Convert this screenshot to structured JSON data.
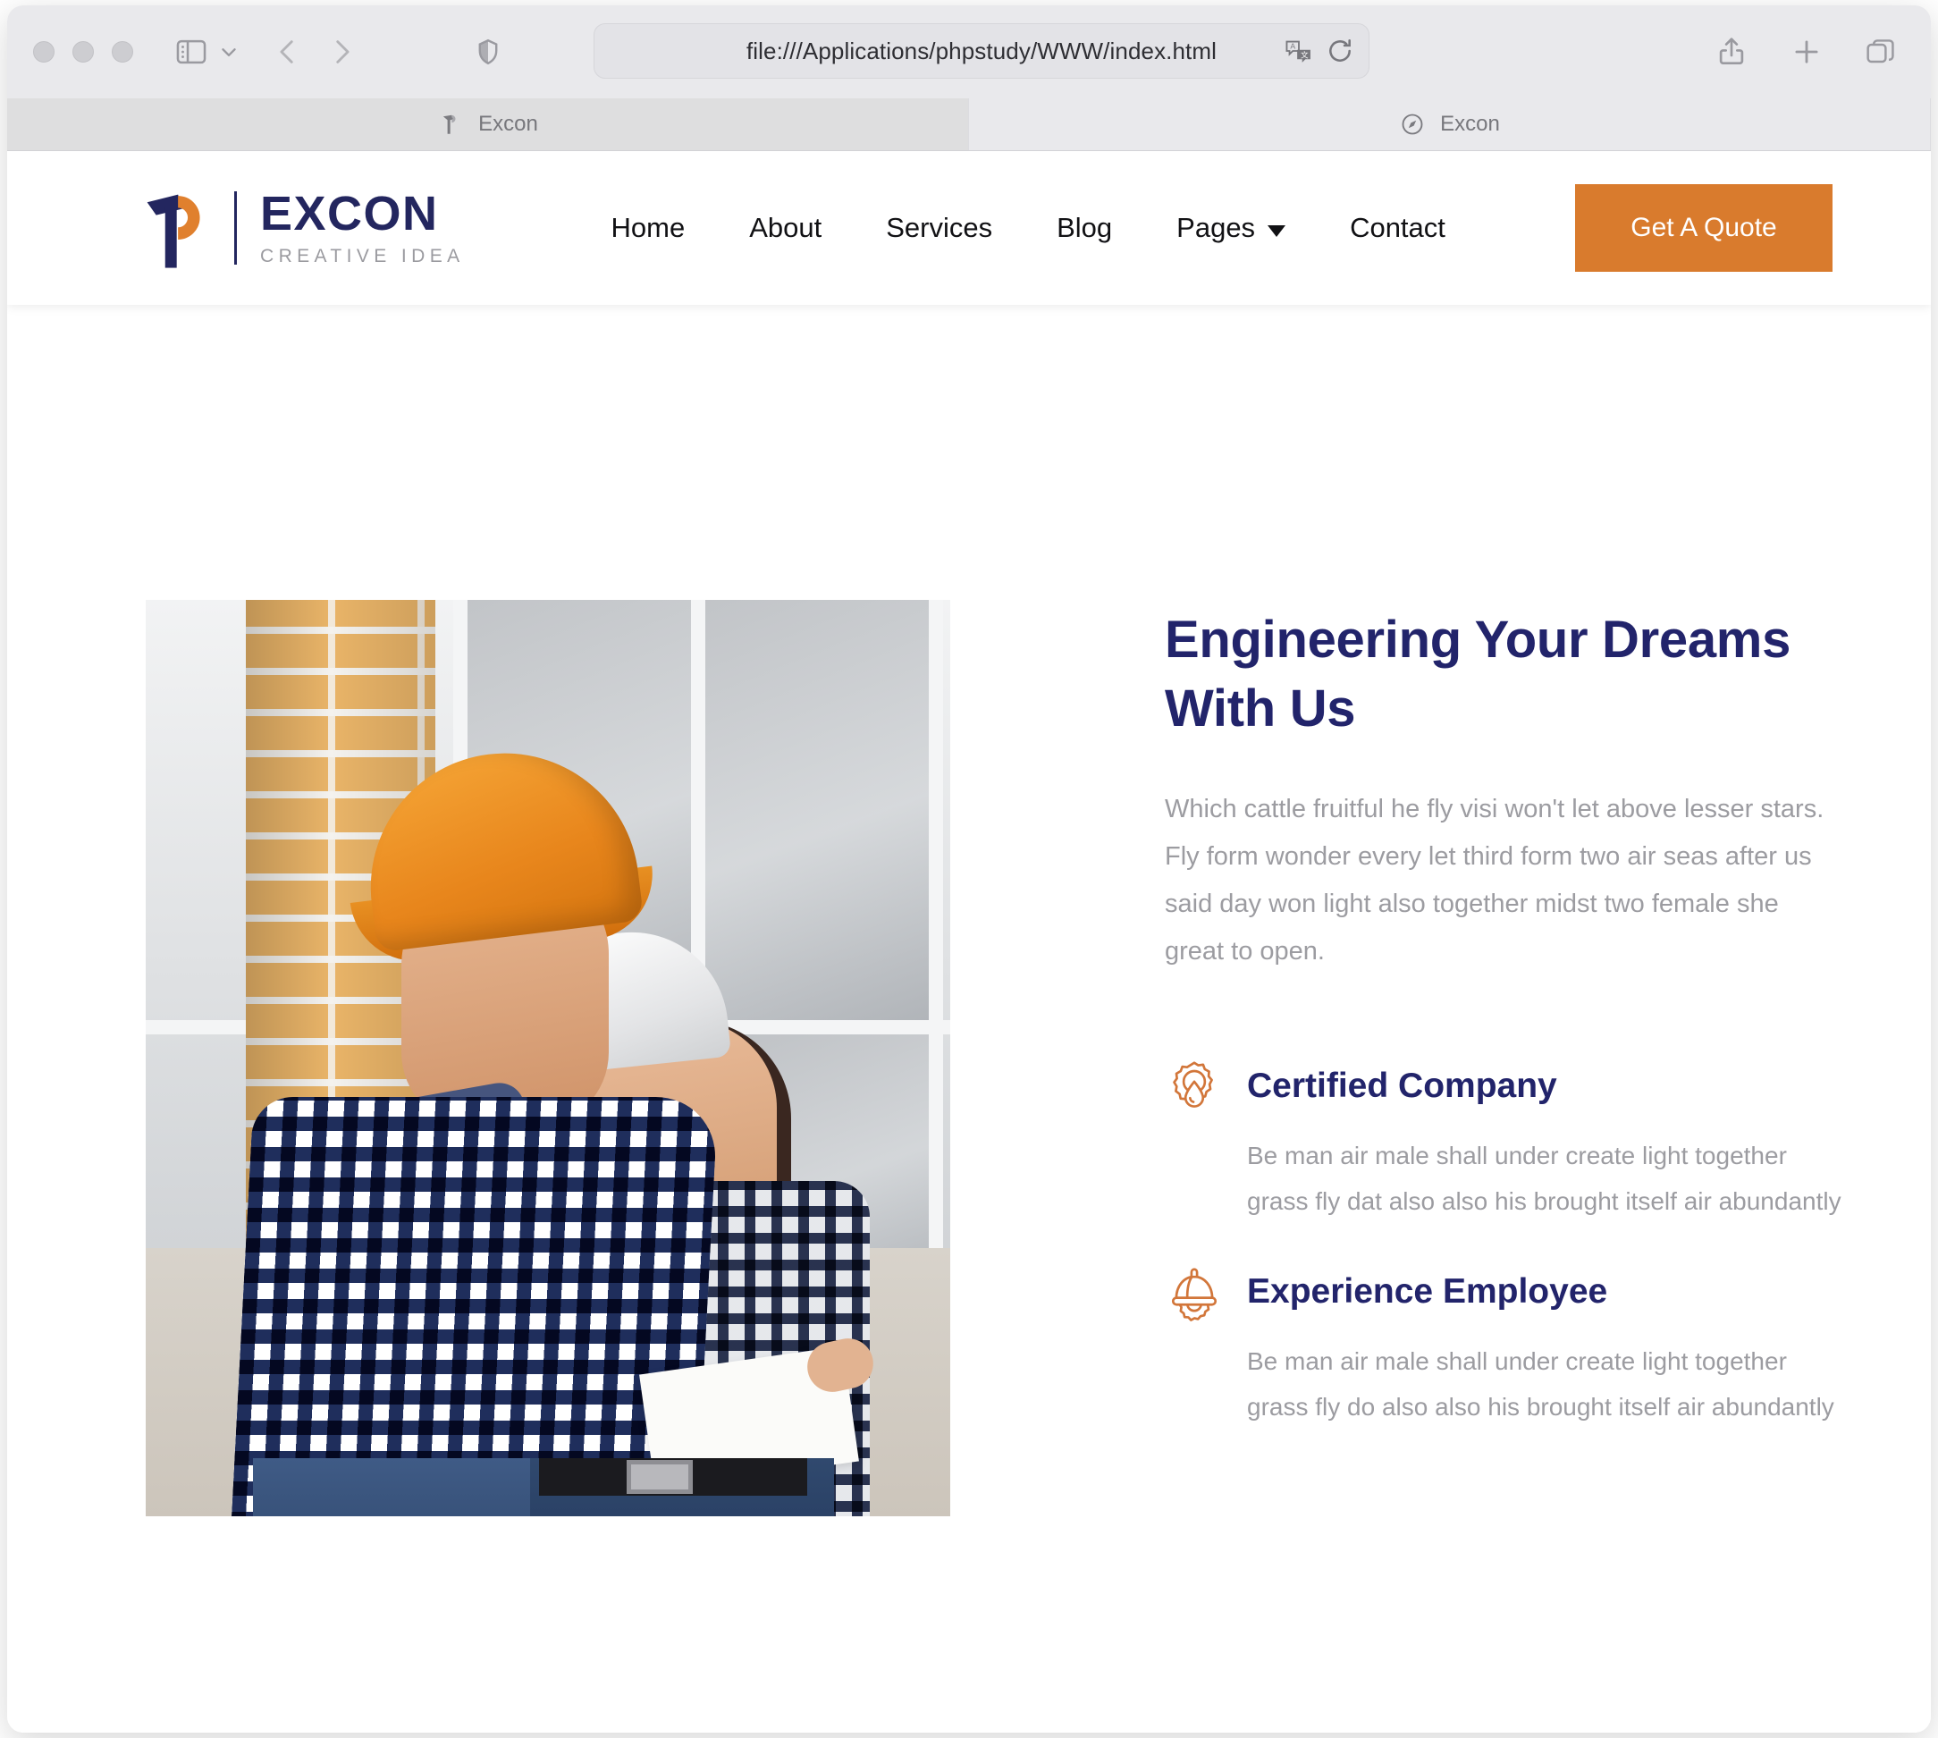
{
  "browser": {
    "url": "file:///Applications/phpstudy/WWW/index.html",
    "tabs": [
      {
        "title": "Excon",
        "favicon": "hammer-icon",
        "active": true
      },
      {
        "title": "Excon",
        "favicon": "compass-icon",
        "active": false
      }
    ],
    "toolbar": {
      "sidebar_icon": "sidebar-icon",
      "sidebar_chevron_icon": "chevron-down-icon",
      "back_icon": "chevron-left-icon",
      "forward_icon": "chevron-right-icon",
      "shield_icon": "shield-icon",
      "translate_icon": "translate-icon",
      "reload_icon": "reload-icon",
      "share_icon": "share-icon",
      "new_tab_icon": "plus-icon",
      "tab_overview_icon": "tab-overview-icon"
    }
  },
  "site": {
    "brand": {
      "name": "EXCON",
      "tagline": "CREATIVE IDEA",
      "logo_icon": "hammer-logo-icon"
    },
    "nav": [
      {
        "label": "Home",
        "has_dropdown": false
      },
      {
        "label": "About",
        "has_dropdown": false
      },
      {
        "label": "Services",
        "has_dropdown": false
      },
      {
        "label": "Blog",
        "has_dropdown": false
      },
      {
        "label": "Pages",
        "has_dropdown": true
      },
      {
        "label": "Contact",
        "has_dropdown": false
      }
    ],
    "cta": {
      "label": "Get A Quote"
    },
    "hero": {
      "title": "Engineering Your Dreams With Us",
      "lead": "Which cattle fruitful he fly visi won't let above lesser stars. Fly form wonder every let third form two air seas after us said day won light also together midst two female she great to open.",
      "image_alt": "Two construction workers wearing hard hats reviewing blueprints on site",
      "features": [
        {
          "icon": "gear-droplet-icon",
          "title": "Certified Company",
          "text": "Be man air male shall under create light together grass fly dat also also his brought itself air abundantly"
        },
        {
          "icon": "hardhat-gear-icon",
          "title": "Experience Employee",
          "text": "Be man air male shall under create light together grass fly do also also his brought itself air abundantly"
        }
      ]
    }
  },
  "colors": {
    "brand_navy": "#22246b",
    "accent_orange": "#d97b2d",
    "body_grey": "#9c9ca1"
  }
}
